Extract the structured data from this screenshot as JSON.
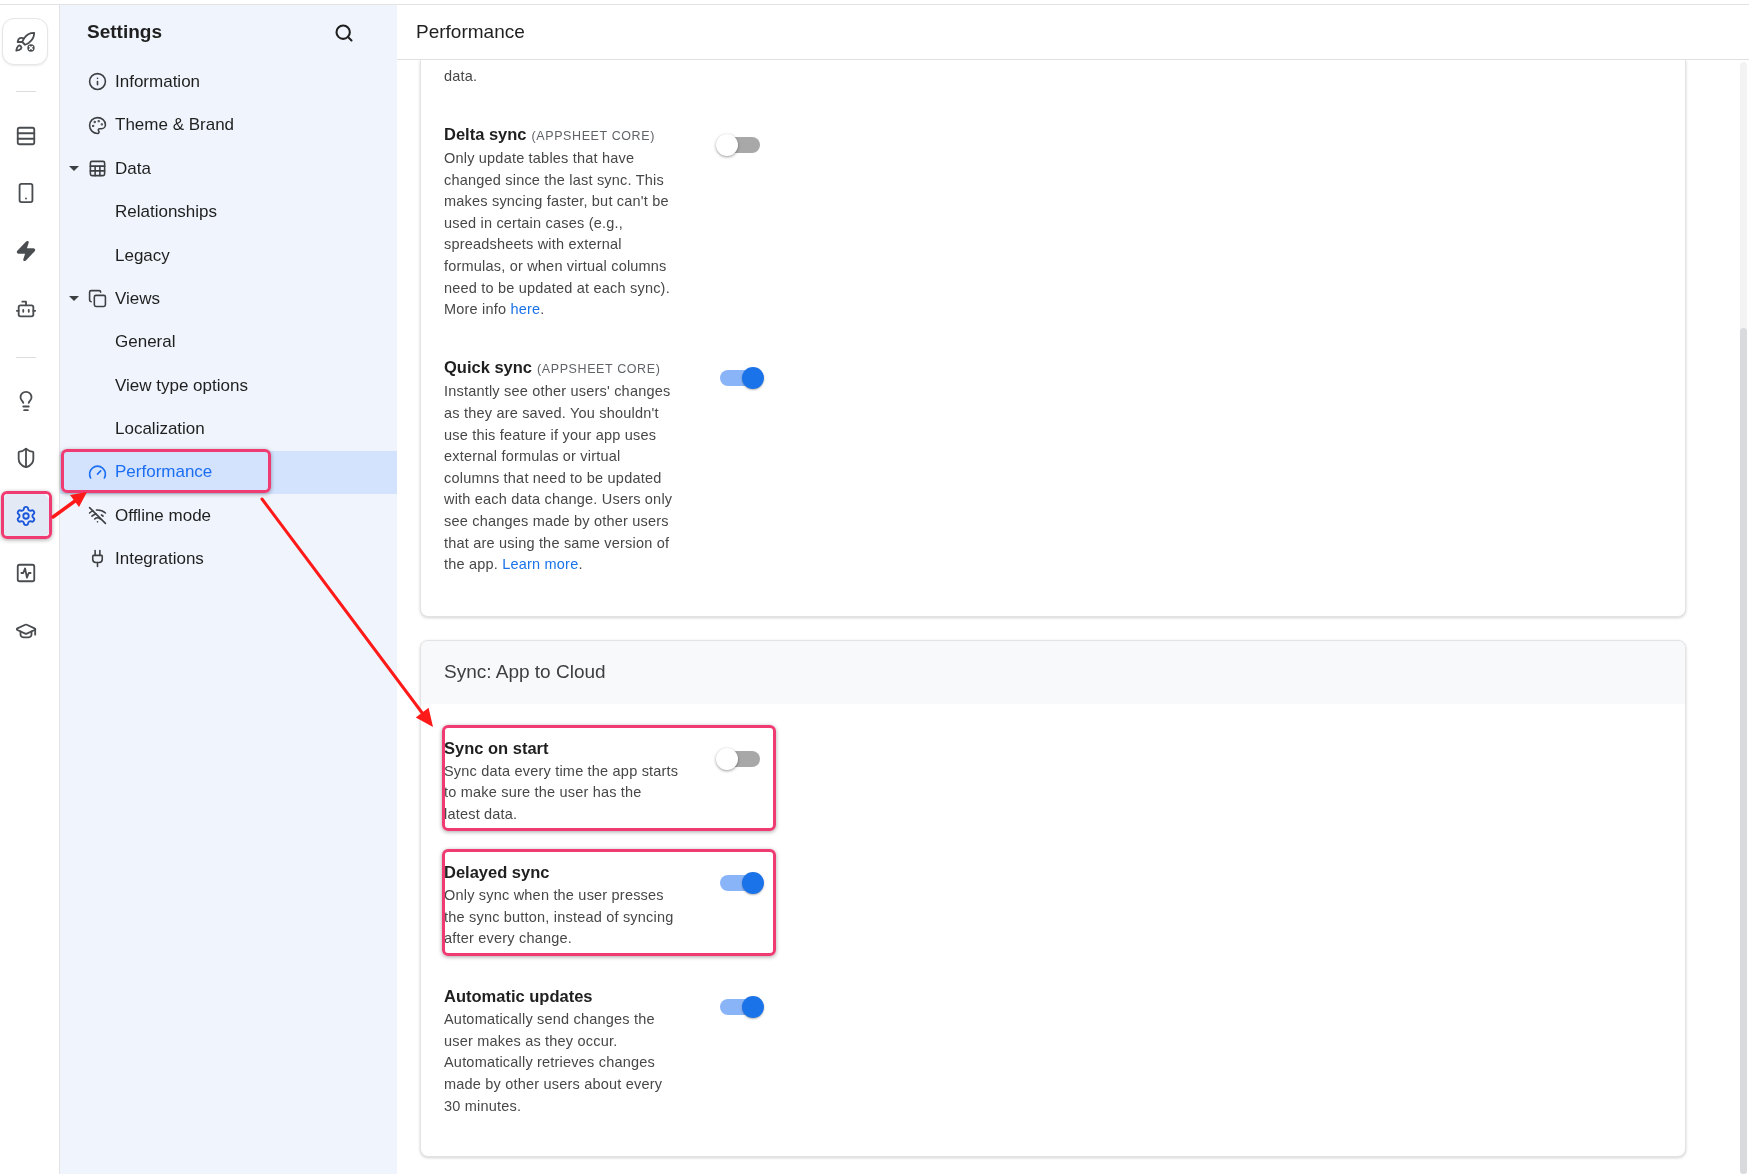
{
  "icon_rail": {
    "groups": [
      {
        "items": [
          {
            "selected": false,
            "highlighted": false
          }
        ]
      },
      {
        "items": [
          {
            "selected": false,
            "highlighted": false
          },
          {
            "selected": false,
            "highlighted": false
          },
          {
            "selected": false,
            "highlighted": false
          },
          {
            "selected": false,
            "highlighted": false
          }
        ]
      },
      {
        "items": [
          {
            "selected": false,
            "highlighted": false
          },
          {
            "selected": false,
            "highlighted": false
          },
          {
            "selected": true,
            "highlighted": true
          },
          {
            "selected": false,
            "highlighted": false
          },
          {
            "selected": false,
            "highlighted": false
          }
        ]
      }
    ]
  },
  "sidebar": {
    "title": "Settings",
    "items": [
      {
        "label": "Information",
        "selected": false,
        "highlighted": false
      },
      {
        "label": "Theme & Brand",
        "selected": false,
        "highlighted": false
      },
      {
        "label": "Data",
        "expanded": true,
        "selected": false,
        "highlighted": false,
        "children": [
          {
            "label": "Relationships",
            "selected": false,
            "highlighted": false
          },
          {
            "label": "Legacy",
            "selected": false,
            "highlighted": false
          }
        ]
      },
      {
        "label": "Views",
        "expanded": true,
        "selected": false,
        "highlighted": false,
        "children": [
          {
            "label": "General",
            "selected": false,
            "highlighted": false
          },
          {
            "label": "View type options",
            "selected": false,
            "highlighted": false
          },
          {
            "label": "Localization",
            "selected": false,
            "highlighted": false
          }
        ]
      },
      {
        "label": "Performance",
        "selected": true,
        "highlighted": true
      },
      {
        "label": "Offline mode",
        "selected": false,
        "highlighted": false
      },
      {
        "label": "Integrations",
        "selected": false,
        "highlighted": false
      }
    ]
  },
  "main": {
    "title": "Performance",
    "sections": [
      {
        "items": [
          {
            "kind": "text",
            "text": "data."
          },
          {
            "kind": "toggle",
            "title": "Delta sync",
            "tag": "(APPSHEET CORE)",
            "description": "Only update tables that have changed since the last sync. This makes syncing faster, but can't be used in certain cases (e.g., spreadsheets with external formulas, or when virtual columns need to be updated at each sync). More info ",
            "link": "here",
            "description_end": ".",
            "on": false,
            "highlighted": false
          },
          {
            "kind": "toggle",
            "title": "Quick sync",
            "tag": "(APPSHEET CORE)",
            "description": "Instantly see other users' changes as they are saved. You shouldn't use this feature if your app uses external formulas or virtual columns that need to be updated with each data change. Users only see changes made by other users that are using the same version of the app. ",
            "link": "Learn more",
            "description_end": ".",
            "on": true,
            "highlighted": false
          }
        ]
      },
      {
        "header": "Sync: App to Cloud",
        "items": [
          {
            "kind": "toggle",
            "title": "Sync on start",
            "description": "Sync data every time the app starts to make sure the user has the latest data.",
            "on": false,
            "highlighted": true
          },
          {
            "kind": "toggle",
            "title": "Delayed sync",
            "description": "Only sync when the user presses the sync button, instead of syncing after every change.",
            "on": true,
            "highlighted": true
          },
          {
            "kind": "toggle",
            "title": "Automatic updates",
            "description": "Automatically send changes the user makes as they occur. Automatically retrieves changes made by other users about every 30 minutes.",
            "on": true,
            "highlighted": false
          }
        ]
      }
    ]
  }
}
